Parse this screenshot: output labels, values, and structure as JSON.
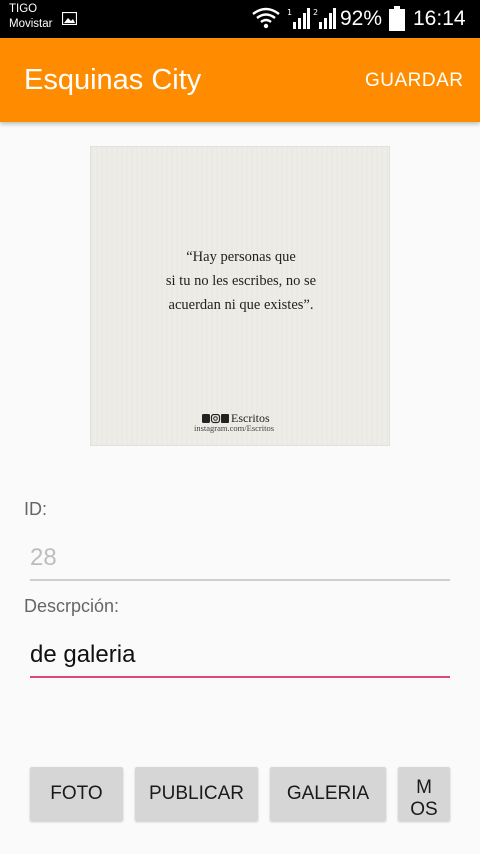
{
  "status_bar": {
    "carrier_1": "TIGO",
    "carrier_2": "Movistar",
    "sim1_label": "1",
    "sim2_label": "2",
    "battery": "92%",
    "time": "16:14"
  },
  "app_bar": {
    "title": "Esquinas City",
    "save_label": "GUARDAR",
    "color": "#ff8c00"
  },
  "photo": {
    "quote_lines": [
      "“Hay personas que",
      "si tu no les escribes, no se",
      "acuerdan ni que existes”."
    ],
    "brand": "Escritos",
    "brand_sub": "instagram.com/Escritos"
  },
  "form": {
    "id_label": "ID:",
    "id_value": "28",
    "description_label": "Descrpción:",
    "description_value": "de galeria",
    "accent_color": "#e0457b"
  },
  "buttons": {
    "foto": "FOTO",
    "publicar": "PUBLICAR",
    "galeria": "GALERIA",
    "mas": "MOS"
  }
}
